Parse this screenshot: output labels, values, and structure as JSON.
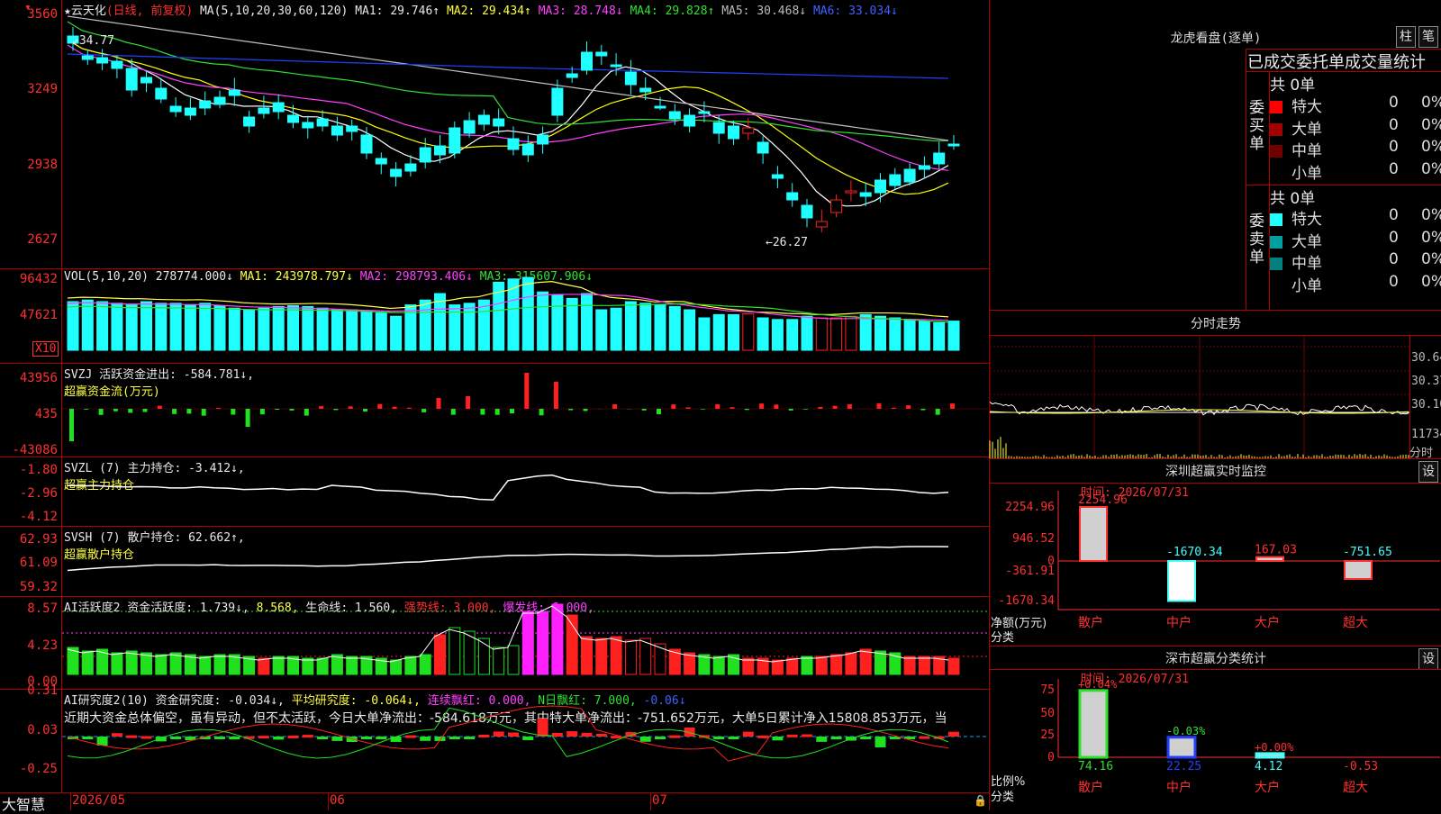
{
  "colors": {
    "up": "#ff2020",
    "down": "#20ffff",
    "ma1": "#ffffff",
    "ma2": "#ffff00",
    "ma3": "#ff40ff",
    "ma4": "#30e030",
    "ma5": "#c0c0c0",
    "ma6": "#2040ff",
    "grid": "#b00000"
  },
  "main": {
    "stock_name": "云天化",
    "period": "(日线, 前复权)",
    "ma_params": "MA(5,10,20,30,60,120)",
    "ma1": "MA1: 29.746↑",
    "ma2": "MA2: 29.434↑",
    "ma3": "MA3: 28.748↓",
    "ma4": "MA4: 29.828↑",
    "ma5": "MA5: 30.468↓",
    "ma6": "MA6: 33.034↓",
    "y_labels": [
      "3560",
      "3249",
      "2938",
      "2627"
    ],
    "high_label": "34.77",
    "low_label": "←26.27"
  },
  "vol": {
    "header": "VOL(5,10,20)",
    "val": "278774.000↓",
    "ma1": "MA1: 243978.797↓",
    "ma2": "MA2: 298793.406↓",
    "ma3": "MA3: 315607.906↓",
    "y_labels": [
      "96432",
      "47621"
    ],
    "unit": "X10"
  },
  "svzj": {
    "title": "SVZJ  活跃资金进出: -584.781↓,",
    "subtitle": "超赢资金流(万元)",
    "y_labels": [
      "43956",
      "435",
      "-43086"
    ]
  },
  "svzl": {
    "title": "SVZL (7) 主力持仓: -3.412↓,",
    "subtitle": "超赢主力持仓",
    "y_labels": [
      "-1.80",
      "-2.96",
      "-4.12"
    ]
  },
  "svsh": {
    "title": "SVSH (7) 散户持仓: 62.662↑,",
    "subtitle": "超赢散户持仓",
    "y_labels": [
      "62.93",
      "61.09",
      "59.32"
    ]
  },
  "ai1": {
    "t1": "AI活跃度2 资金活跃度: 1.739↓,",
    "t2": "8.568,",
    "t3": "生命线: 1.560,",
    "t4": "强势线: 3.000,",
    "t5": "爆发线: 6.000,",
    "y_labels": [
      "8.57",
      "4.23",
      "0.00"
    ]
  },
  "ai2": {
    "t1": "AI研究度2(10) 资金研究度: -0.034↓,",
    "t2": "平均研究度: -0.064↓,",
    "t3": "连续飘红: 0.000,",
    "t4": "N日飘红: 7.000,",
    "t5": "-0.06↓",
    "comment": "近期大资金总体偏空，虽有异动，但不太活跃，今日大单净流出：-584.618万元，其中特大单净流出：-751.652万元，大单5日累计净入15808.853万元，当",
    "y_labels": [
      "0.31",
      "0.03",
      "-0.25"
    ]
  },
  "xaxis": {
    "logo": "大智慧",
    "labels": [
      "2026/05",
      "06",
      "07"
    ]
  },
  "lhb": {
    "title": "龙虎看盘(逐单)",
    "btn1": "柱",
    "btn2": "笔",
    "sub": "已成交委托单成交量统计",
    "buy_side": "委买单",
    "sell_side": "委卖单",
    "buy_total": "共 0单",
    "sell_total": "共 0单",
    "buy_rows": [
      {
        "label": "特大",
        "v": "0",
        "p": "0%",
        "c": "#ff0000"
      },
      {
        "label": "大单",
        "v": "0",
        "p": "0%",
        "c": "#a00000"
      },
      {
        "label": "中单",
        "v": "0",
        "p": "0%",
        "c": "#700000"
      },
      {
        "label": "小单",
        "v": "0",
        "p": "0%",
        "c": "#000000"
      }
    ],
    "sell_rows": [
      {
        "label": "特大",
        "v": "0",
        "p": "0%",
        "c": "#20ffff"
      },
      {
        "label": "大单",
        "v": "0",
        "p": "0%",
        "c": "#00a0a0"
      },
      {
        "label": "中单",
        "v": "0",
        "p": "0%",
        "c": "#008080"
      },
      {
        "label": "小单",
        "v": "0",
        "p": "0%",
        "c": "#000000"
      }
    ]
  },
  "intraday": {
    "title": "分时走势",
    "right_labels": [
      "30.64",
      "30.37",
      "30.10",
      "11734"
    ],
    "unit": "分时"
  },
  "szmon": {
    "title": "深圳超赢实时监控",
    "btn": "设",
    "time": "时间: 2026/07/31",
    "y_labels": [
      "2254.96",
      "946.52",
      "0",
      "-361.91",
      "-1670.34"
    ],
    "ylabel": "净额(万元)",
    "xlabel": "分类",
    "categories": [
      "散户",
      "中户",
      "大户",
      "超大"
    ],
    "values": [
      2254.96,
      -1670.34,
      167.03,
      -751.65
    ],
    "value_labels": [
      "2254.96",
      "-1670.34",
      "167.03",
      "-751.65"
    ]
  },
  "szcls": {
    "title": "深市超赢分类统计",
    "btn": "设",
    "time": "时间: 2026/07/31",
    "y_labels": [
      "75",
      "50",
      "25",
      "0"
    ],
    "ylabel": "比例%",
    "xlabel": "分类",
    "categories": [
      "散户",
      "中户",
      "大户",
      "超大"
    ],
    "values": [
      74.16,
      22.25,
      4.12,
      -0.53
    ],
    "bottom_labels": [
      "74.16",
      "22.25",
      "4.12",
      "-0.53"
    ],
    "top_labels": [
      "+0.04%",
      "-0.03%",
      "+0.00%",
      ""
    ]
  }
}
